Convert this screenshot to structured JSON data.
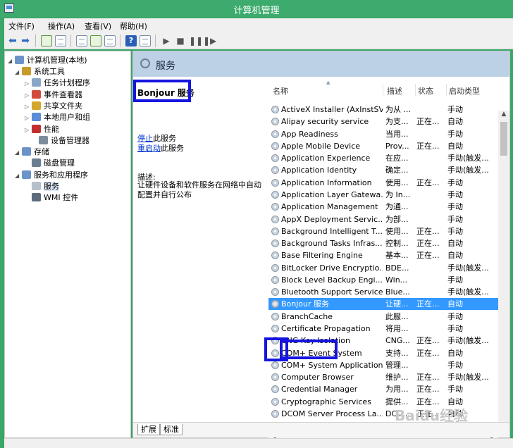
{
  "window": {
    "title": "计算机管理"
  },
  "menu": [
    "文件(F)",
    "操作(A)",
    "查看(V)",
    "帮助(H)"
  ],
  "toolbar": {
    "icons": [
      "back-arrow-icon",
      "forward-arrow-icon",
      "up-folder-icon",
      "show-hide-tree-icon",
      "properties-icon",
      "refresh-icon",
      "export-icon",
      "help-icon",
      "show-hide-action-icon",
      "start-service-icon",
      "stop-service-icon",
      "pause-service-icon",
      "restart-service-icon"
    ]
  },
  "tree": {
    "root": "计算机管理(本地)",
    "items": [
      {
        "label": "系统工具",
        "expander": "◢",
        "color": "#c79a2c"
      },
      {
        "label": "任务计划程序",
        "expander": "▷",
        "color": "#8aa6c8"
      },
      {
        "label": "事件查看器",
        "expander": "▷",
        "color": "#d24b3c"
      },
      {
        "label": "共享文件夹",
        "expander": "▷",
        "color": "#d4a72c"
      },
      {
        "label": "本地用户和组",
        "expander": "▷",
        "color": "#5a8ad8"
      },
      {
        "label": "性能",
        "expander": "▷",
        "color": "#c03030"
      },
      {
        "label": "设备管理器",
        "expander": "",
        "color": "#7c8c9c"
      },
      {
        "label": "存储",
        "expander": "◢",
        "color": "#6b93c9"
      },
      {
        "label": "磁盘管理",
        "expander": "",
        "color": "#6b7d90"
      },
      {
        "label": "服务和应用程序",
        "expander": "◢",
        "color": "#6b93c9"
      },
      {
        "label": "服务",
        "expander": "",
        "color": "#b5c0cc"
      },
      {
        "label": "WMI 控件",
        "expander": "",
        "color": "#5c6c7c"
      }
    ]
  },
  "header": {
    "title": "服务"
  },
  "details": {
    "service_name": "Bonjour 服务",
    "stop_link": "停止",
    "stop_suffix": "此服务",
    "restart_link": "重启动",
    "restart_suffix": "此服务",
    "desc_label": "描述:",
    "desc_text": "让硬件设备和软件服务在网络中自动配置并自行公布"
  },
  "columns": {
    "name": "名称",
    "desc": "描述",
    "status": "状态",
    "startup": "启动类型"
  },
  "services": [
    {
      "name": "ActiveX Installer (AxInstSV)",
      "desc": "为从 ...",
      "status": "",
      "startup": "手动"
    },
    {
      "name": "Alipay security service",
      "desc": "为支...",
      "status": "正在...",
      "startup": "自动"
    },
    {
      "name": "App Readiness",
      "desc": "当用...",
      "status": "",
      "startup": "手动"
    },
    {
      "name": "Apple Mobile Device",
      "desc": "Prov...",
      "status": "正在...",
      "startup": "自动"
    },
    {
      "name": "Application Experience",
      "desc": "在应...",
      "status": "",
      "startup": "手动(触发..."
    },
    {
      "name": "Application Identity",
      "desc": "确定...",
      "status": "",
      "startup": "手动(触发..."
    },
    {
      "name": "Application Information",
      "desc": "使用...",
      "status": "正在...",
      "startup": "手动"
    },
    {
      "name": "Application Layer Gatewa...",
      "desc": "为 In...",
      "status": "",
      "startup": "手动"
    },
    {
      "name": "Application Management",
      "desc": "为通...",
      "status": "",
      "startup": "手动"
    },
    {
      "name": "AppX Deployment Servic...",
      "desc": "为部...",
      "status": "",
      "startup": "手动"
    },
    {
      "name": "Background Intelligent T...",
      "desc": "使用...",
      "status": "正在...",
      "startup": "手动"
    },
    {
      "name": "Background Tasks Infras...",
      "desc": "控制...",
      "status": "正在...",
      "startup": "自动"
    },
    {
      "name": "Base Filtering Engine",
      "desc": "基本...",
      "status": "正在...",
      "startup": "自动"
    },
    {
      "name": "BitLocker Drive Encryptio...",
      "desc": "BDE...",
      "status": "",
      "startup": "手动(触发..."
    },
    {
      "name": "Block Level Backup Engi...",
      "desc": "Win...",
      "status": "",
      "startup": "手动"
    },
    {
      "name": "Bluetooth Support Service",
      "desc": "Blue...",
      "status": "",
      "startup": "手动(触发..."
    },
    {
      "name": "Bonjour 服务",
      "desc": "让硬...",
      "status": "正在...",
      "startup": "自动",
      "selected": true
    },
    {
      "name": "BranchCache",
      "desc": "此服...",
      "status": "",
      "startup": "手动"
    },
    {
      "name": "Certificate Propagation",
      "desc": "将用...",
      "status": "",
      "startup": "手动"
    },
    {
      "name": "CNG Key Isolation",
      "desc": "CNG...",
      "status": "正在...",
      "startup": "手动(触发..."
    },
    {
      "name": "COM+ Event System",
      "desc": "支持...",
      "status": "正在...",
      "startup": "自动"
    },
    {
      "name": "COM+ System Application",
      "desc": "管理...",
      "status": "",
      "startup": "手动"
    },
    {
      "name": "Computer Browser",
      "desc": "维护...",
      "status": "正在...",
      "startup": "手动(触发..."
    },
    {
      "name": "Credential Manager",
      "desc": "为用...",
      "status": "正在...",
      "startup": "手动"
    },
    {
      "name": "Cryptographic Services",
      "desc": "提供...",
      "status": "正在...",
      "startup": "自动"
    },
    {
      "name": "DCOM Server Process La...",
      "desc": "DCO...",
      "status": "正在...",
      "startup": "自动"
    }
  ],
  "tabs": [
    "扩展",
    "标准"
  ],
  "watermark": "Baidu经验"
}
